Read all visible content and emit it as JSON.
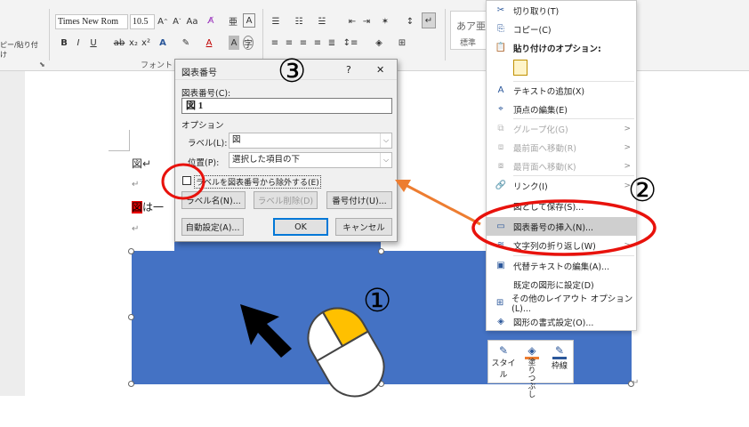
{
  "ribbon": {
    "font_name": "Times New Rom",
    "font_size": "10.5",
    "paste_label": "ピー/貼り付け",
    "font_group_label": "フォント",
    "style_preview": "あア亜",
    "style_label": "標準"
  },
  "document": {
    "line1": "図↵",
    "line2": "↵",
    "line3_highlight": "図",
    "line3_text": "は一",
    "line4": "↵"
  },
  "dialog": {
    "title": "図表番号",
    "help": "?",
    "close": "✕",
    "caption_label": "図表番号(C):",
    "caption_value": "図 1",
    "options_label": "オプション",
    "label_label": "ラベル(L):",
    "label_value": "図",
    "position_label": "位置(P):",
    "position_value": "選択した項目の下",
    "exclude_label": "ラベルを図表番号から除外する(E)",
    "new_label_btn": "ラベル名(N)...",
    "delete_label_btn": "ラベル削除(D)",
    "numbering_btn": "番号付け(U)...",
    "autocaption_btn": "自動設定(A)...",
    "ok_btn": "OK",
    "cancel_btn": "キャンセル"
  },
  "context_menu": {
    "items": [
      {
        "icon": "✂",
        "label": "切り取り(T)",
        "disabled": false
      },
      {
        "icon": "⎘",
        "label": "コピー(C)",
        "disabled": false
      },
      {
        "icon": "📋",
        "label": "貼り付けのオプション:",
        "disabled": false,
        "bold": true
      },
      {
        "icon": "A",
        "label": "テキストの追加(X)",
        "disabled": false
      },
      {
        "icon": "⌖",
        "label": "頂点の編集(E)",
        "disabled": false
      },
      {
        "icon": "⧉",
        "label": "グループ化(G)",
        "disabled": true,
        "sub": ">"
      },
      {
        "icon": "⧈",
        "label": "最前面へ移動(R)",
        "disabled": true,
        "sub": ">"
      },
      {
        "icon": "⧇",
        "label": "最背面へ移動(K)",
        "disabled": true,
        "sub": ">"
      },
      {
        "icon": "🔗",
        "label": "リンク(I)",
        "disabled": false,
        "sub": ">"
      },
      {
        "icon": "",
        "label": "図として保存(S)...",
        "disabled": false
      },
      {
        "icon": "▭",
        "label": "図表番号の挿入(N)...",
        "disabled": false
      },
      {
        "icon": "≋",
        "label": "文字列の折り返し(W)",
        "disabled": false,
        "sub": ">"
      },
      {
        "icon": "▣",
        "label": "代替テキストの編集(A)...",
        "disabled": false
      },
      {
        "icon": "",
        "label": "既定の図形に設定(D)",
        "disabled": false
      },
      {
        "icon": "⊞",
        "label": "その他のレイアウト オプション(L)...",
        "disabled": false
      },
      {
        "icon": "◈",
        "label": "図形の書式設定(O)...",
        "disabled": false
      }
    ]
  },
  "mini_toolbar": {
    "style": "スタイル",
    "fill": "塗りつぶし",
    "outline": "枠線"
  },
  "annotations": {
    "n1": "①",
    "n2": "②",
    "n3": "③"
  },
  "colors": {
    "shape_blue": "#4472c4",
    "annotation_red": "#e8120c",
    "arrow_orange": "#ed7d31",
    "mouse_yellow": "#ffc000"
  }
}
